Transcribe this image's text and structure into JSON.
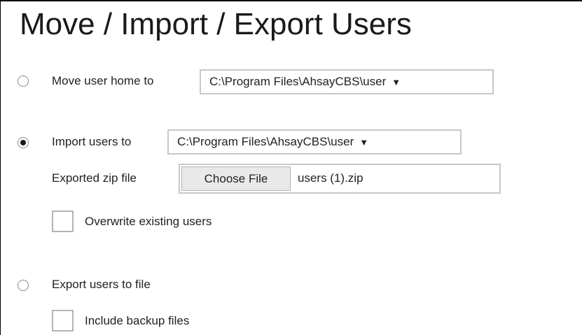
{
  "title": "Move / Import / Export Users",
  "move": {
    "label": "Move user home to",
    "selected": false,
    "path": "C:\\Program Files\\AhsayCBS\\user",
    "arrow": "▼"
  },
  "import": {
    "label": "Import users to",
    "selected": true,
    "path": "C:\\Program Files\\AhsayCBS\\user",
    "arrow": "▼",
    "zip_label": "Exported zip file",
    "choose_button": "Choose File",
    "file_name": "users (1).zip",
    "overwrite_label": "Overwrite existing users",
    "overwrite_checked": false
  },
  "export": {
    "label": "Export users to file",
    "selected": false,
    "include_label": "Include backup files",
    "include_checked": false
  }
}
